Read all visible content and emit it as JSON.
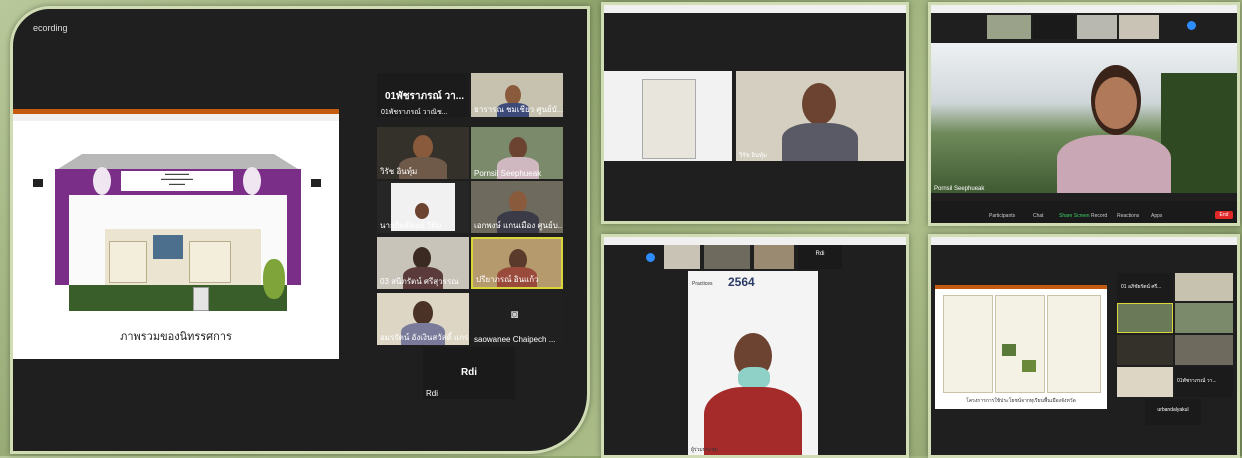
{
  "panel1": {
    "recording_label": "ecording",
    "slide_caption": "ภาพรวมของนิทรรศการ",
    "speaker_name": "01พัชราภรณ์ วา...",
    "speaker_sub": "01พัชราภรณ์ วาณิช...",
    "participants": [
      "ธารารณ ชมเชียว ศูนย์บั...",
      "วิรัช อินทุ์ม",
      "Pornsil Seephueak",
      "นายกิตติพงษ์ วีทิม",
      "เอกพงษ์ แกนเมือง ศูนย์บ...",
      "03 สนิภรัตน์ ศรีสุวรรณ",
      "ปรียาภรณ์ อินแก้ว",
      "อมรรัตน์ อังเงินสวัสดิ์ แกร...",
      "saowanee Chaipech ...",
      "Rdi"
    ],
    "rdi_tile_title": "Rdi",
    "rdi_tile_label": "Rdi"
  },
  "panel2": {
    "name_label": "วิรัช อินทุ์ม"
  },
  "panel3": {
    "bar_items": [
      "Participants",
      "Chat",
      "Share Screen",
      "Record",
      "Reactions",
      "Apps"
    ],
    "name_label": "Pornsil Seephueak",
    "end_label": "End"
  },
  "panel4": {
    "year": "2564",
    "heading": "Practices",
    "name_label": "ผู้ร่วมประชุม",
    "rdi": "Rdi"
  },
  "panel5": {
    "slide_caption": "โครงการการใช้ประโยชน์จากทุเรียนพื้นเมืองจังหวัด",
    "name_1": "01 อภิชัยรัตน์ ศรี...",
    "name_2": "01พัชราภรณ์ วา...",
    "rdi_name": "urbandalyakul"
  }
}
